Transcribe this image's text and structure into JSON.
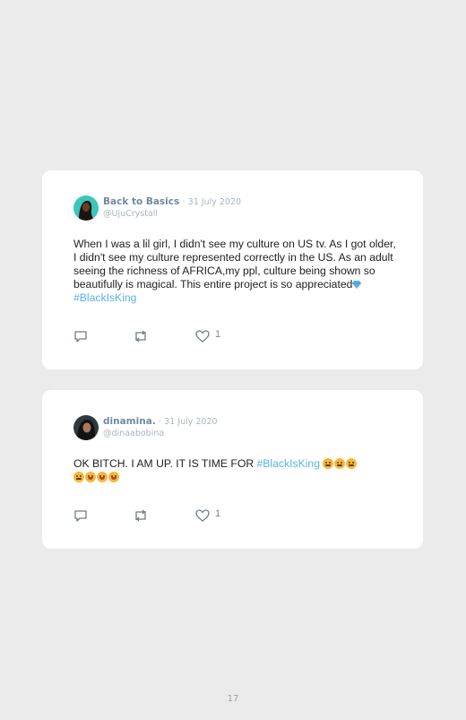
{
  "tweets": [
    {
      "author": "Back to Basics",
      "separator": "·",
      "date": "31 July 2020",
      "handle": "@UjuCrystall",
      "text_before": "When I was a lil girl, I didn't see my culture on US tv. As I got older, I didn't see my culture represented correctly in the US. As an adult seeing the richness of AFRICA,my ppl, culture being shown so beautifully is magical. This entire project is so appreciated",
      "hashtag": "#BlackIsKing",
      "likes": "1"
    },
    {
      "author": "dinamina.",
      "separator": "·",
      "date": "31 July 2020",
      "handle": "@dinaabobina",
      "text_before": "OK BITCH. I AM UP. IT IS TIME FOR ",
      "hashtag": "#BlackIsKing",
      "likes": "1"
    }
  ],
  "colors": {
    "accent": "#5ab0e6",
    "name": "#6f8aa2",
    "muted": "#a9b4bf"
  },
  "page_number": "17"
}
